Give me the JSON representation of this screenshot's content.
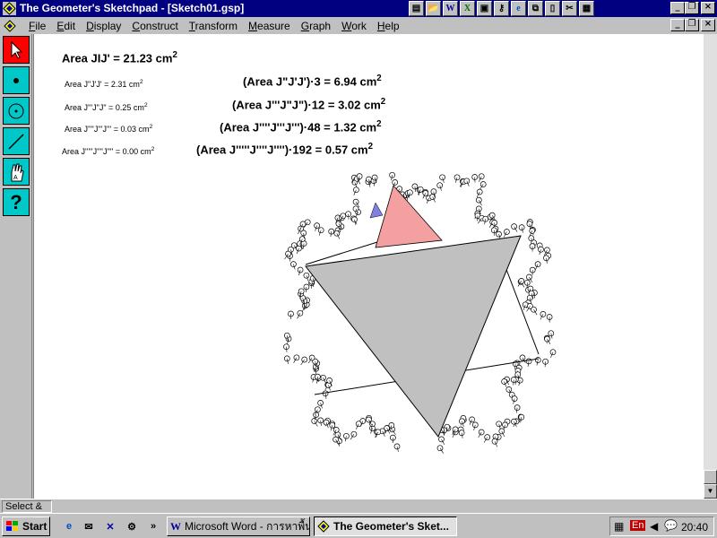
{
  "window": {
    "title": "The Geometer's Sketchpad - [Sketch01.gsp]"
  },
  "quick_launch_titlebar": [
    "notepad-icon",
    "folder-icon",
    "word-icon",
    "excel-icon",
    "monitor-icon",
    "key-icon",
    "explorer-icon",
    "network-icon",
    "document-icon",
    "tools-icon",
    "computer-icon"
  ],
  "menu": {
    "items": [
      {
        "label": "File",
        "u": "F",
        "rest": "ile"
      },
      {
        "label": "Edit",
        "u": "E",
        "rest": "dit"
      },
      {
        "label": "Display",
        "u": "D",
        "rest": "isplay"
      },
      {
        "label": "Construct",
        "u": "C",
        "rest": "onstruct"
      },
      {
        "label": "Transform",
        "u": "T",
        "rest": "ransform"
      },
      {
        "label": "Measure",
        "u": "M",
        "rest": "easure"
      },
      {
        "label": "Graph",
        "u": "G",
        "rest": "raph"
      },
      {
        "label": "Work",
        "u": "W",
        "rest": "ork"
      },
      {
        "label": "Help",
        "u": "H",
        "rest": "elp"
      }
    ]
  },
  "tools": [
    "selection-arrow-tool",
    "point-tool",
    "compass-tool",
    "straightedge-tool",
    "text-tool",
    "object-info-tool"
  ],
  "measurements": {
    "main": {
      "text": "Area JIJ' = 21.23 cm",
      "sup": "2"
    },
    "left": [
      {
        "text": "Area J\"J'J' = 2.31 cm",
        "sup": "2"
      },
      {
        "text": "Area J'''J\"J\" = 0.25 cm",
        "sup": "2"
      },
      {
        "text": "Area J''''J'''J''' = 0.03 cm",
        "sup": "2"
      },
      {
        "text": "Area J'''''J''''J'''' = 0.00 cm",
        "sup": "2"
      }
    ],
    "right": [
      {
        "text": "(Area J\"J'J')·3 = 6.94 cm",
        "sup": "2"
      },
      {
        "text": "(Area J'''J\"J\")·12 = 3.02 cm",
        "sup": "2"
      },
      {
        "text": "(Area J''''J'''J''')·48 = 1.32 cm",
        "sup": "2"
      },
      {
        "text": "(Area J'''''J''''J'''')·192 = 0.57 cm",
        "sup": "2"
      }
    ]
  },
  "statusbar": {
    "text": "Select &"
  },
  "taskbar": {
    "start_label": "Start",
    "tasks": [
      {
        "label": "Microsoft Word - การหาพื้น...",
        "active": false
      },
      {
        "label": "The Geometer's Sket...",
        "active": true
      }
    ],
    "tray_lang": "En",
    "clock": "20:40"
  },
  "colors": {
    "titlebar": "#000080",
    "selected_tool": "#ff0000",
    "tool": "#00c8c8",
    "triangle_fill": "#c0c0c0",
    "pink_triangle": "#f4a0a0",
    "blue_triangle": "#8080e0"
  }
}
